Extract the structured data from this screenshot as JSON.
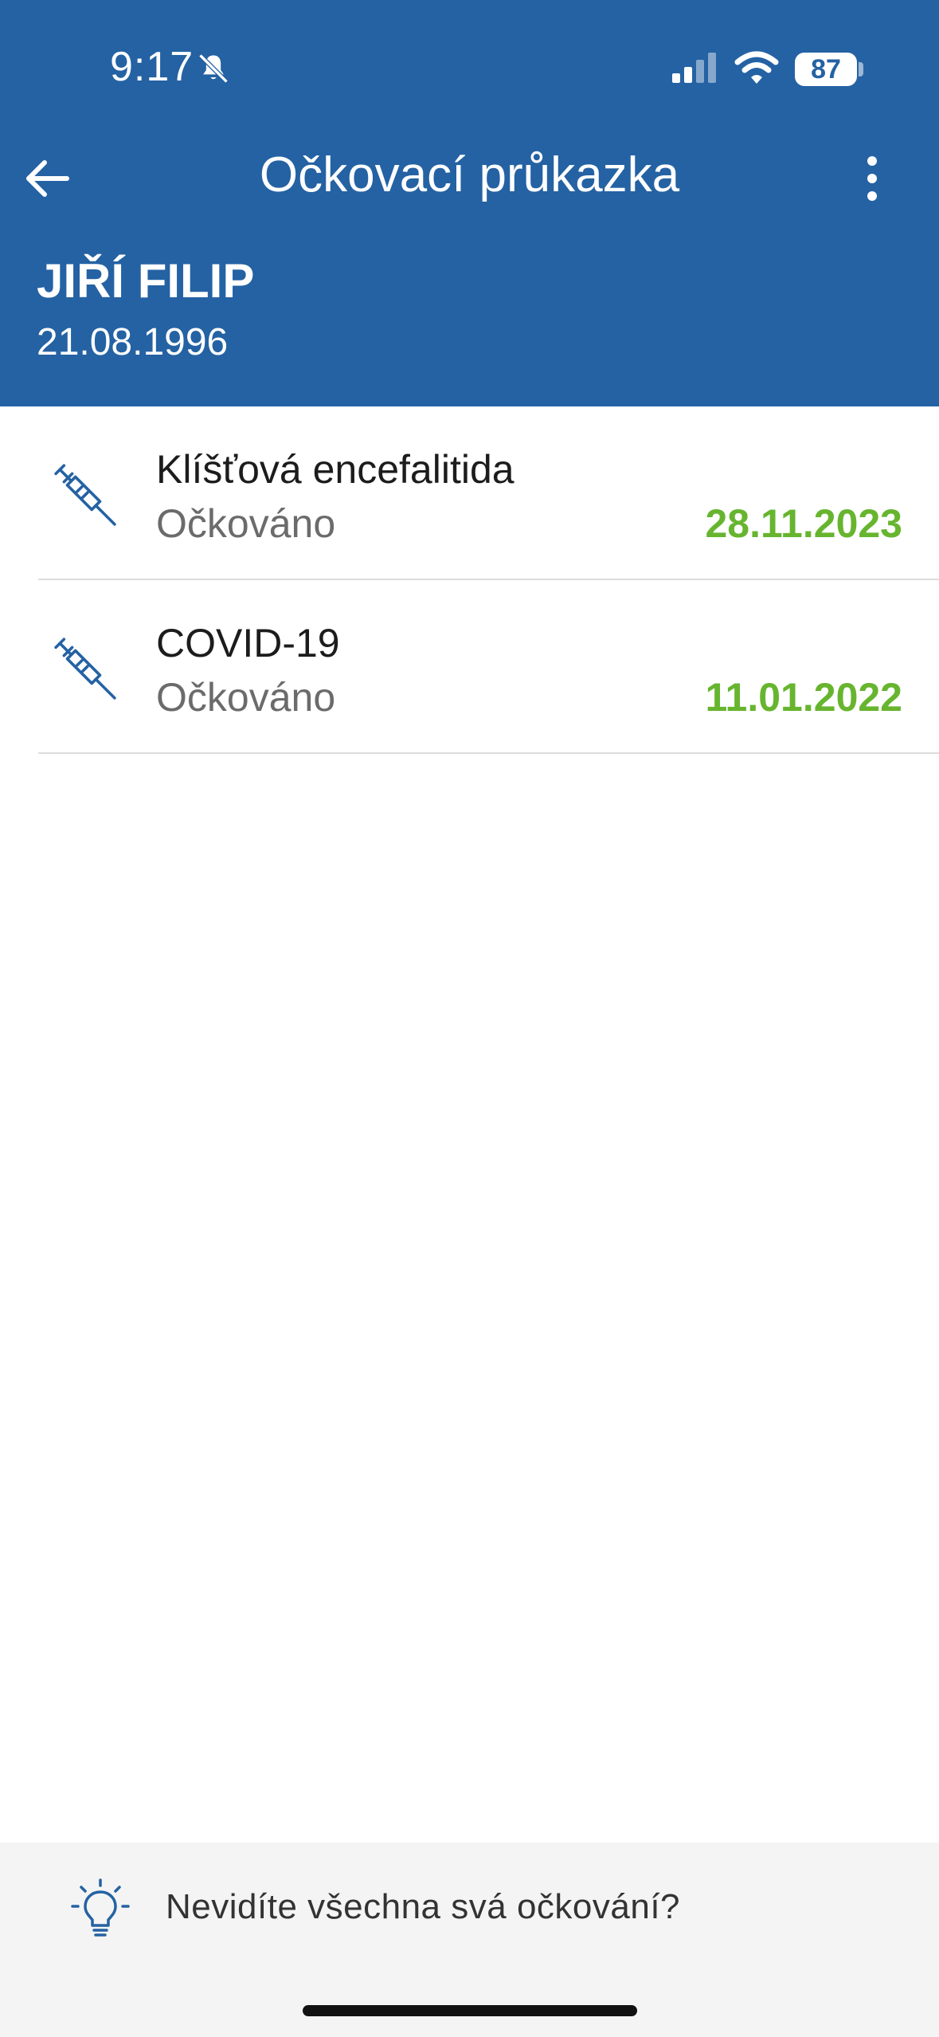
{
  "status_bar": {
    "time": "9:17",
    "battery": "87"
  },
  "nav": {
    "title": "Očkovací průkazka",
    "back_icon": "arrow-left-icon",
    "more_icon": "more-vertical-icon"
  },
  "person": {
    "name": "JIŘÍ FILIP",
    "birth_date": "21.08.1996"
  },
  "vaccinations": [
    {
      "name": "Klíšťová encefalitida",
      "status": "Očkováno",
      "date": "28.11.2023",
      "icon": "syringe-icon"
    },
    {
      "name": "COVID-19",
      "status": "Očkováno",
      "date": "11.01.2022",
      "icon": "syringe-icon"
    }
  ],
  "info": {
    "text": "Nevidíte všechna svá očkování?",
    "icon": "lightbulb-icon"
  },
  "colors": {
    "header": "#2462A3",
    "date_green": "#67B52F",
    "icon_blue": "#2462A3"
  }
}
